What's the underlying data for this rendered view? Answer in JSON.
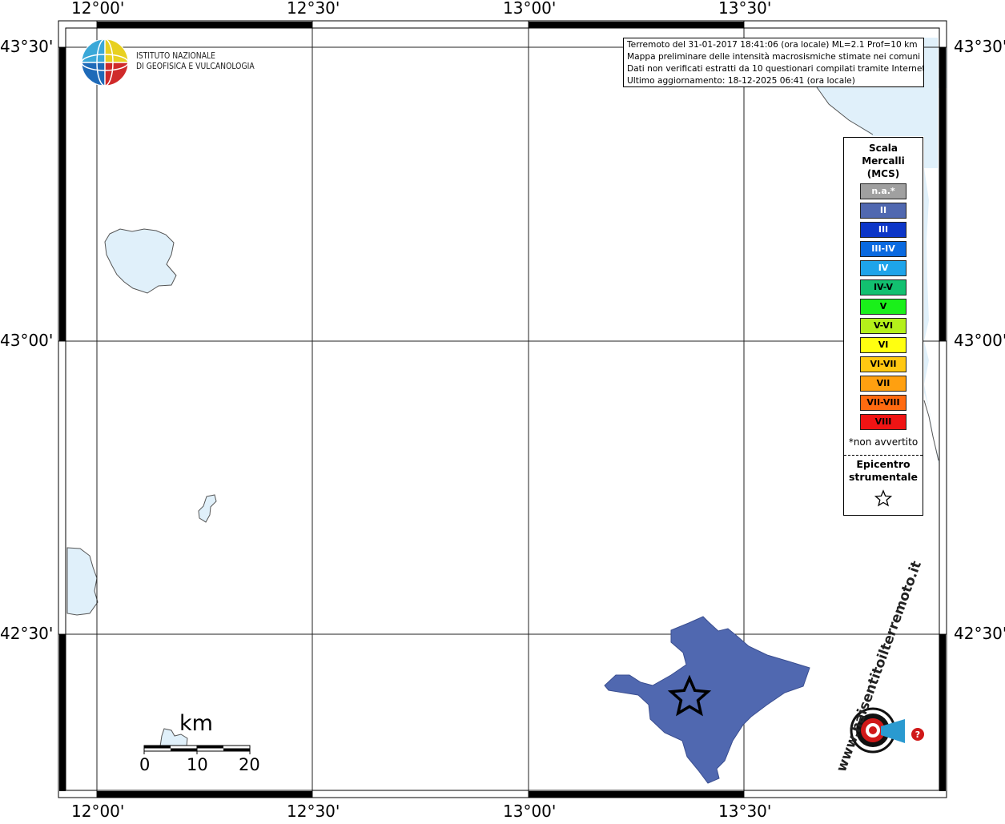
{
  "map": {
    "lon_labels": [
      "12°00'",
      "12°30'",
      "13°00'",
      "13°30'"
    ],
    "lat_labels": [
      "43°30'",
      "43°00'",
      "42°30'"
    ]
  },
  "info": {
    "lines": [
      "Terremoto del 31-01-2017 18:41:06 (ora locale) ML=2.1 Prof=10 km",
      "Mappa preliminare delle intensità macrosismiche stimate nei comuni",
      "Dati non verificati estratti da 10 questionari compilati tramite Internet.",
      "Ultimo aggiornamento: 18-12-2025 06:41 (ora locale)"
    ]
  },
  "legend": {
    "title_lines": [
      "Scala",
      "Mercalli",
      "(MCS)"
    ],
    "items": [
      {
        "label": "n.a.*",
        "color": "#a0a0a0",
        "text_color": "#ffffff"
      },
      {
        "label": "II",
        "color": "#5068b0",
        "text_color": "#ffffff"
      },
      {
        "label": "III",
        "color": "#0c36c8",
        "text_color": "#ffffff"
      },
      {
        "label": "III-IV",
        "color": "#0a6ae0",
        "text_color": "#ffffff"
      },
      {
        "label": "IV",
        "color": "#1ea4ea",
        "text_color": "#ffffff"
      },
      {
        "label": "IV-V",
        "color": "#12c070",
        "text_color": "#000000"
      },
      {
        "label": "V",
        "color": "#1af01a",
        "text_color": "#000000"
      },
      {
        "label": "V-VI",
        "color": "#b4f01a",
        "text_color": "#000000"
      },
      {
        "label": "VI",
        "color": "#ffff10",
        "text_color": "#000000"
      },
      {
        "label": "VI-VII",
        "color": "#ffc812",
        "text_color": "#000000"
      },
      {
        "label": "VII",
        "color": "#ffa010",
        "text_color": "#000000"
      },
      {
        "label": "VII-VIII",
        "color": "#ff6a10",
        "text_color": "#000000"
      },
      {
        "label": "VIII",
        "color": "#f01414",
        "text_color": "#000000"
      }
    ],
    "note": "*non avvertito",
    "epicenter_lines": [
      "Epicentro",
      "strumentale"
    ]
  },
  "logo_ingv": {
    "lines": [
      "ISTITUTO NAZIONALE",
      "DI GEOFISICA E VULCANOLOGIA"
    ]
  },
  "scale_bar": {
    "unit": "km",
    "ticks": [
      "0",
      "10",
      "20"
    ]
  },
  "logo_hsit": {
    "text": "www.haisentitoilterremoto.it"
  },
  "colors": {
    "water": "#e0f0fa",
    "intensity_region": "#5068b0"
  }
}
